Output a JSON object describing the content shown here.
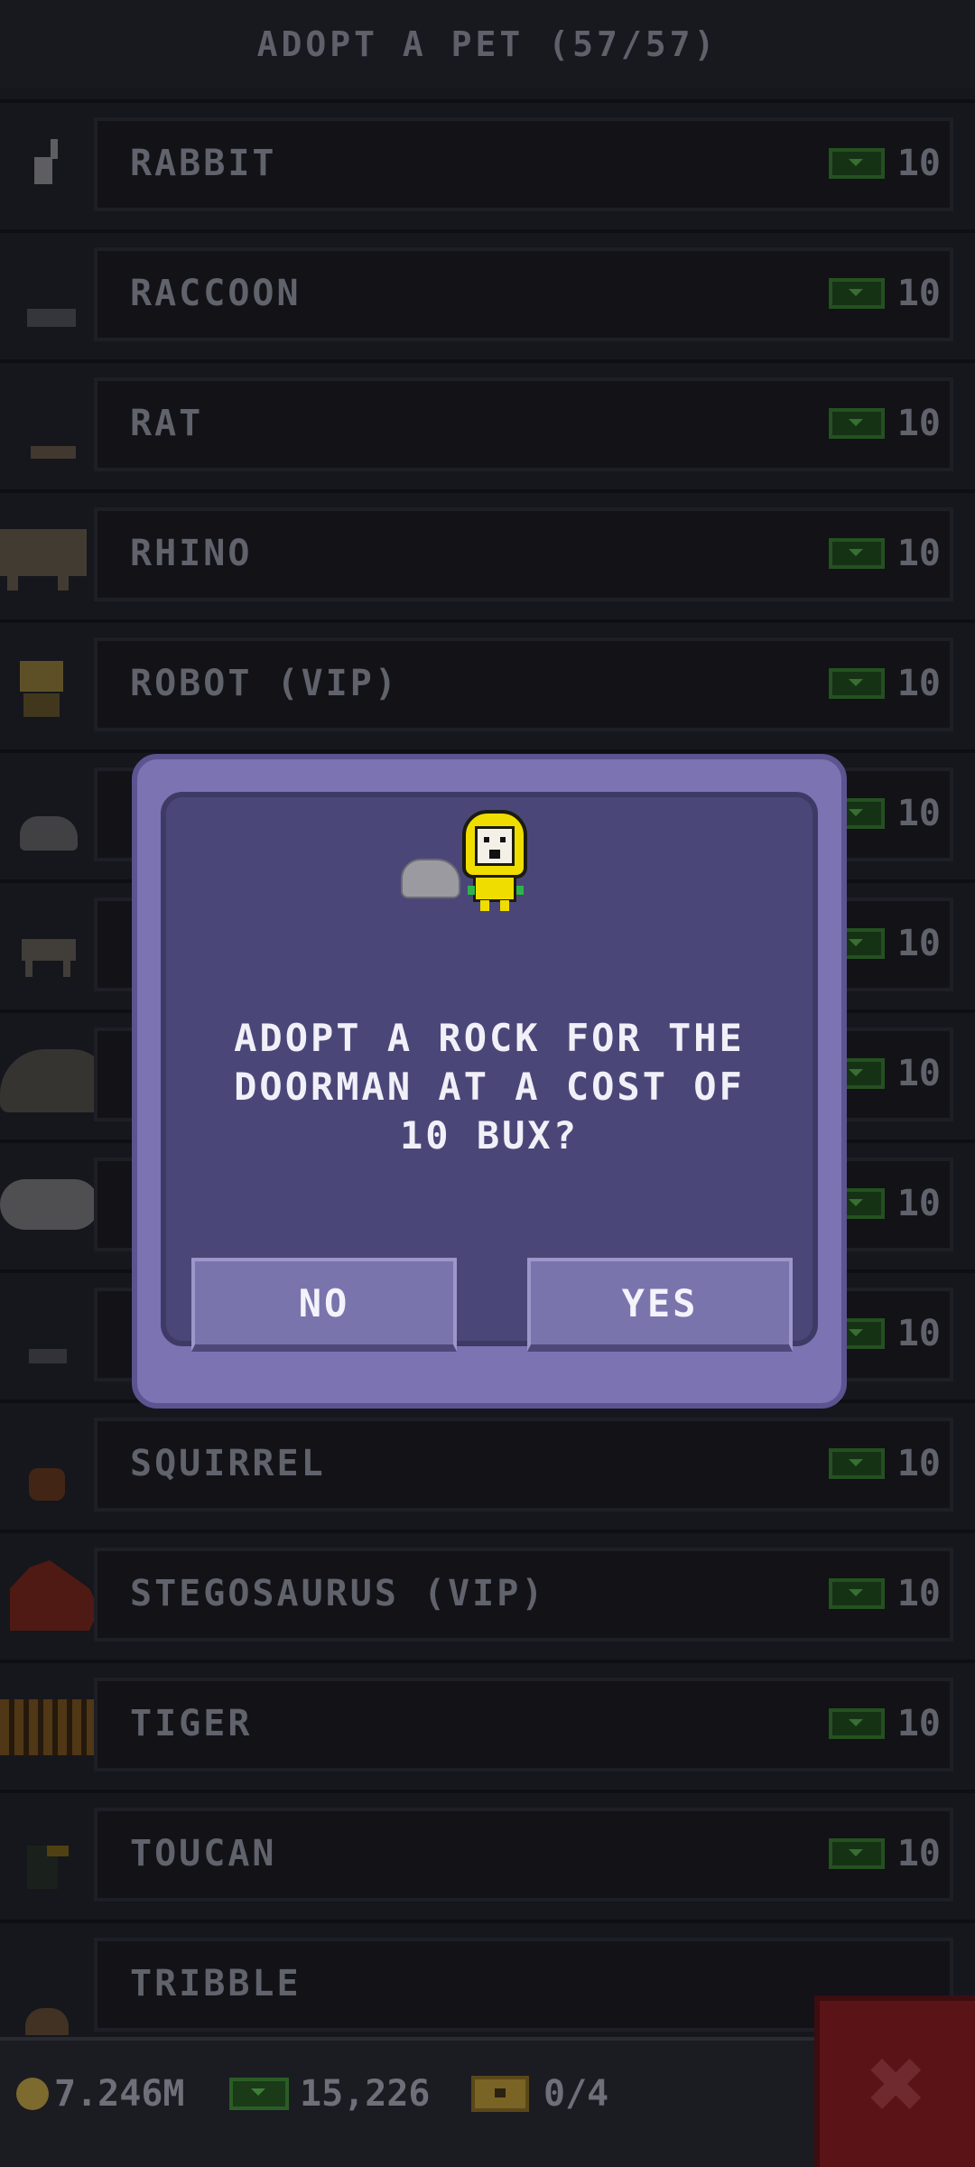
{
  "header": {
    "title": "ADOPT A PET (57/57)"
  },
  "pets": [
    {
      "label": "RABBIT",
      "price": "10"
    },
    {
      "label": "RACCOON",
      "price": "10"
    },
    {
      "label": "RAT",
      "price": "10"
    },
    {
      "label": "RHINO",
      "price": "10"
    },
    {
      "label": "ROBOT (VIP)",
      "price": "10"
    },
    {
      "label": "",
      "price": "10"
    },
    {
      "label": "",
      "price": "10"
    },
    {
      "label": "",
      "price": "10"
    },
    {
      "label": "",
      "price": "10"
    },
    {
      "label": "",
      "price": "10"
    },
    {
      "label": "SQUIRREL",
      "price": "10"
    },
    {
      "label": "STEGOSAURUS (VIP)",
      "price": "10"
    },
    {
      "label": "TIGER",
      "price": "10"
    },
    {
      "label": "TOUCAN",
      "price": "10"
    },
    {
      "label": "TRIBBLE",
      "price": ""
    }
  ],
  "dialog": {
    "message": "ADOPT A ROCK FOR THE DOORMAN AT A COST OF 10 BUX?",
    "no_label": "NO",
    "yes_label": "YES"
  },
  "footer": {
    "coins": "7.246M",
    "bux": "15,226",
    "chests": "0/4"
  },
  "colors": {
    "dialog_bg": "#4a4778",
    "dialog_frame": "#7b73b2",
    "button": "#7a74ad",
    "close_button": "#5a1418",
    "bux_green": "#2a5d25"
  },
  "icons": [
    "rabbit-icon",
    "raccoon-icon",
    "rat-icon",
    "rhino-icon",
    "robot-icon",
    "rock-icon",
    "doorman-icon",
    "coin-icon",
    "bux-icon",
    "chest-icon",
    "close-icon"
  ]
}
